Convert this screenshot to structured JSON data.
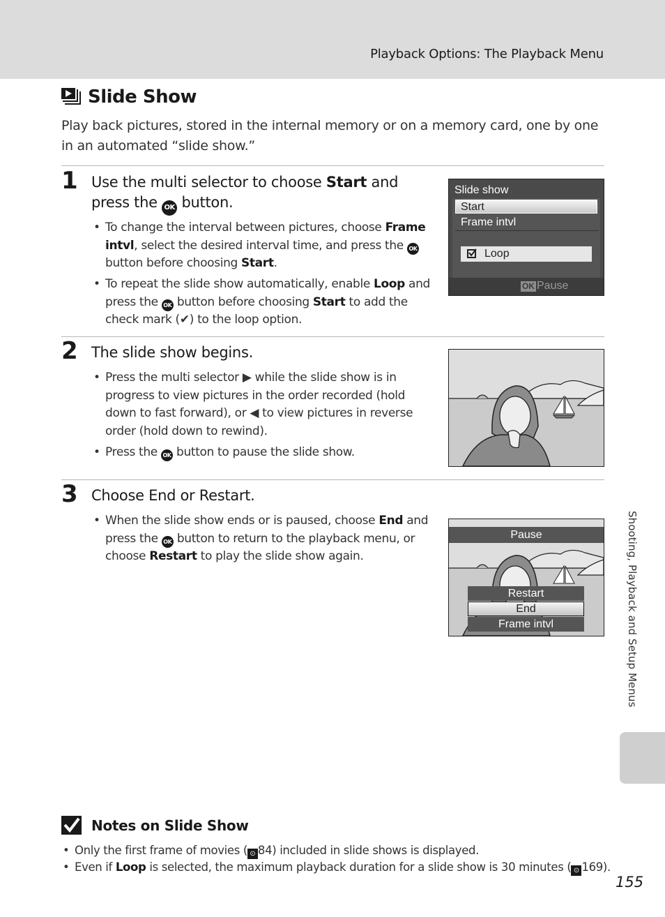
{
  "header": {
    "section_title": "Playback Options: The Playback Menu"
  },
  "page": {
    "title": "Slide Show",
    "title_icon": "slideshow-icon",
    "intro": "Play back pictures, stored in the internal memory or on a memory card, one by one in an automated “slide show.”"
  },
  "steps": [
    {
      "number": "1",
      "title_parts": [
        "Use the multi selector to choose ",
        "Start",
        " and press the ",
        "OK",
        " button."
      ],
      "bullets": [
        [
          "To change the interval between pictures, choose ",
          "Frame intvl",
          ", select the desired interval time, and press the ",
          "OK",
          " button before choosing ",
          "Start",
          "."
        ],
        [
          "To repeat the slide show automatically, enable ",
          "Loop",
          " and press the ",
          "OK",
          " button before choosing ",
          "Start",
          " to add the check mark (",
          "✔",
          ") to the loop option."
        ]
      ]
    },
    {
      "number": "2",
      "title": "The slide show begins.",
      "bullets": [
        [
          "Press the multi selector ",
          "▶",
          " while the slide show is in progress to view pictures in the order recorded (hold down to fast forward), or ",
          "◀",
          " to view pictures in reverse order (hold down to rewind)."
        ],
        [
          "Press the ",
          "OK",
          " button to pause the slide show."
        ]
      ]
    },
    {
      "number": "3",
      "title": "Choose End or Restart.",
      "bullets": [
        [
          "When the slide show ends or is paused, choose ",
          "End",
          " and press the ",
          "OK",
          " button to return to the playback menu, or choose ",
          "Restart",
          " to play the slide show again."
        ]
      ]
    }
  ],
  "screen1": {
    "title": "Slide show",
    "items": [
      "Start",
      "Frame intvl"
    ],
    "selected": "Start",
    "loop_label": "Loop",
    "loop_checked": true,
    "footer_ok": "OK",
    "footer_label": "Pause"
  },
  "screen3": {
    "title": "Pause",
    "items": [
      "Restart",
      "End",
      "Frame intvl"
    ],
    "selected": "End"
  },
  "notes": {
    "title": "Notes on Slide Show",
    "items": [
      [
        "Only the first frame of movies (",
        "ref-icon",
        "84) included in slide shows is displayed."
      ],
      [
        "Even if ",
        "Loop",
        " is selected, the maximum playback duration for a slide show is 30 minutes (",
        "ref-icon",
        "169)."
      ]
    ]
  },
  "side_tab": {
    "label": "Shooting, Playback and Setup Menus"
  },
  "page_number": "155",
  "glyphs": {
    "ok": "OK",
    "bullet": "•",
    "ref": "⊙"
  },
  "colors": {
    "header_band": "#dcdcdc",
    "side_tab": "#cfcfcf",
    "screen_dark": "#4a4a4a"
  }
}
